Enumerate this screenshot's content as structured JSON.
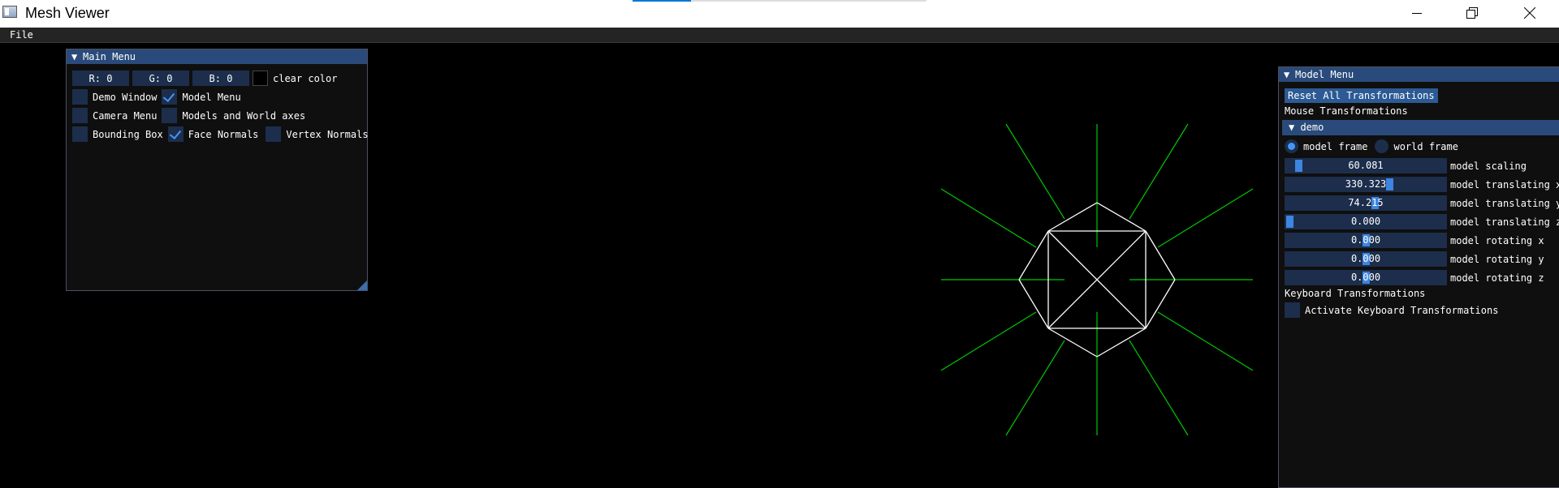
{
  "window": {
    "title": "Mesh Viewer"
  },
  "menubar": {
    "file": "File"
  },
  "main_menu": {
    "title": "Main Menu",
    "clear_r": "R:  0",
    "clear_g": "G:  0",
    "clear_b": "B:  0",
    "clear_color_label": "clear color",
    "checkboxes": [
      {
        "label": "Demo Window",
        "checked": false
      },
      {
        "label": "Model Menu",
        "checked": true
      },
      {
        "label": "Camera Menu",
        "checked": false
      },
      {
        "label": "Models and World axes",
        "checked": false
      },
      {
        "label": "Bounding Box",
        "checked": false
      },
      {
        "label": "Face Normals",
        "checked": true
      },
      {
        "label": "Vertex Normals",
        "checked": false
      }
    ]
  },
  "model_menu": {
    "title": "Model Menu",
    "reset_button": "Reset All Transformations",
    "mouse_section": "Mouse Transformations",
    "model_header": "demo",
    "frame_options": [
      {
        "label": "model frame",
        "selected": true
      },
      {
        "label": "world frame",
        "selected": false
      }
    ],
    "sliders": [
      {
        "value": "60.081",
        "label": "model scaling",
        "fraction": 0.06
      },
      {
        "value": "330.323",
        "label": "model translating x",
        "fraction": 0.66
      },
      {
        "value": "74.215",
        "label": "model translating y",
        "fraction": 0.56
      },
      {
        "value": "0.000",
        "label": "model translating z",
        "fraction": 0.0
      },
      {
        "value": "0.000",
        "label": "model rotating x",
        "fraction": 0.5
      },
      {
        "value": "0.000",
        "label": "model rotating y",
        "fraction": 0.5
      },
      {
        "value": "0.000",
        "label": "model rotating z",
        "fraction": 0.5
      }
    ],
    "keyboard_section": "Keyboard Transformations",
    "keyboard_checkbox": "Activate Keyboard Transformations"
  },
  "colors": {
    "mesh_lines": "#ffffff",
    "normal_lines": "#00c800",
    "header": "#294a7a",
    "frame_bg": "#1c2e4c",
    "accent": "#4296fa"
  }
}
